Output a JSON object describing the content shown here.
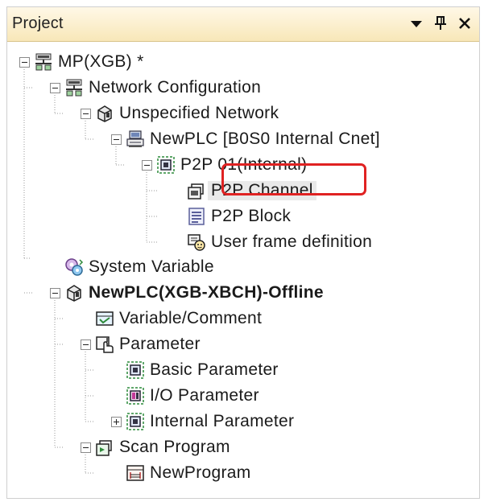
{
  "panel": {
    "title": "Project",
    "buttons": [
      {
        "name": "dropdown-arrow-icon"
      },
      {
        "name": "pin-icon"
      },
      {
        "name": "close-icon"
      }
    ]
  },
  "tree": [
    {
      "label": "MP(XGB) *",
      "toggle": "minus",
      "icon": "network-icon",
      "bold": false,
      "selected": false
    },
    {
      "label": "Network Configuration",
      "toggle": "minus",
      "icon": "network-icon",
      "bold": false,
      "selected": false
    },
    {
      "label": "Unspecified Network",
      "toggle": "minus",
      "icon": "cube-icon",
      "bold": false,
      "selected": false
    },
    {
      "label": "NewPLC [B0S0 Internal Cnet]",
      "toggle": "minus",
      "icon": "plc-icon",
      "bold": false,
      "selected": false
    },
    {
      "label": "P2P 01(Internal)",
      "toggle": "minus",
      "icon": "module-icon",
      "bold": false,
      "selected": false
    },
    {
      "label": "P2P Channel",
      "toggle": "none",
      "icon": "channel-icon",
      "bold": false,
      "selected": true
    },
    {
      "label": "P2P Block",
      "toggle": "none",
      "icon": "block-list-icon",
      "bold": false,
      "selected": false
    },
    {
      "label": "User frame definition",
      "toggle": "none",
      "icon": "frame-icon",
      "bold": false,
      "selected": false
    },
    {
      "label": "System Variable",
      "toggle": "none",
      "icon": "system-variable-icon",
      "bold": false,
      "selected": false
    },
    {
      "label": "NewPLC(XGB-XBCH)-Offline",
      "toggle": "minus",
      "icon": "cube-icon",
      "bold": true,
      "selected": false
    },
    {
      "label": "Variable/Comment",
      "toggle": "none",
      "icon": "variable-icon",
      "bold": false,
      "selected": false
    },
    {
      "label": "Parameter",
      "toggle": "minus",
      "icon": "hand-icon",
      "bold": false,
      "selected": false
    },
    {
      "label": "Basic Parameter",
      "toggle": "none",
      "icon": "parameter-icon",
      "bold": false,
      "selected": false
    },
    {
      "label": "I/O Parameter",
      "toggle": "none",
      "icon": "io-parameter-icon",
      "bold": false,
      "selected": false
    },
    {
      "label": "Internal Parameter",
      "toggle": "plus",
      "icon": "parameter-icon",
      "bold": false,
      "selected": false
    },
    {
      "label": "Scan Program",
      "toggle": "minus",
      "icon": "scan-program-icon",
      "bold": false,
      "selected": false
    },
    {
      "label": "NewProgram",
      "toggle": "none",
      "icon": "program-icon",
      "bold": false,
      "selected": false
    }
  ],
  "colors": {
    "titlebar": "#f8e7b8",
    "highlight_border": "#e02222",
    "selection": "#e9e9e9"
  }
}
